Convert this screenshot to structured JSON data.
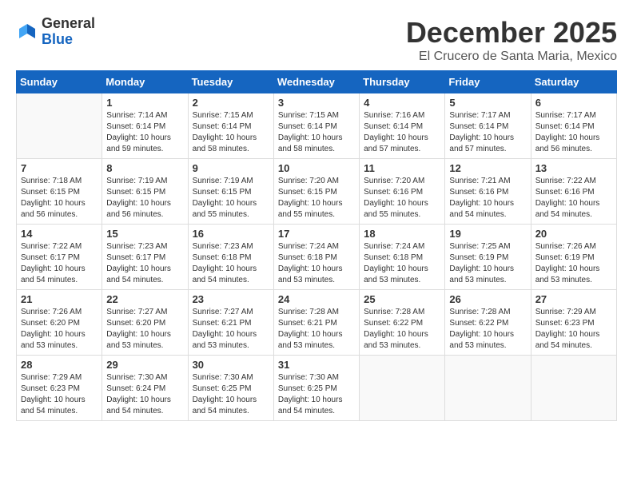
{
  "header": {
    "logo_general": "General",
    "logo_blue": "Blue",
    "month_year": "December 2025",
    "location": "El Crucero de Santa Maria, Mexico"
  },
  "days_of_week": [
    "Sunday",
    "Monday",
    "Tuesday",
    "Wednesday",
    "Thursday",
    "Friday",
    "Saturday"
  ],
  "weeks": [
    [
      {
        "day": "",
        "info": ""
      },
      {
        "day": "1",
        "info": "Sunrise: 7:14 AM\nSunset: 6:14 PM\nDaylight: 10 hours\nand 59 minutes."
      },
      {
        "day": "2",
        "info": "Sunrise: 7:15 AM\nSunset: 6:14 PM\nDaylight: 10 hours\nand 58 minutes."
      },
      {
        "day": "3",
        "info": "Sunrise: 7:15 AM\nSunset: 6:14 PM\nDaylight: 10 hours\nand 58 minutes."
      },
      {
        "day": "4",
        "info": "Sunrise: 7:16 AM\nSunset: 6:14 PM\nDaylight: 10 hours\nand 57 minutes."
      },
      {
        "day": "5",
        "info": "Sunrise: 7:17 AM\nSunset: 6:14 PM\nDaylight: 10 hours\nand 57 minutes."
      },
      {
        "day": "6",
        "info": "Sunrise: 7:17 AM\nSunset: 6:14 PM\nDaylight: 10 hours\nand 56 minutes."
      }
    ],
    [
      {
        "day": "7",
        "info": "Sunrise: 7:18 AM\nSunset: 6:15 PM\nDaylight: 10 hours\nand 56 minutes."
      },
      {
        "day": "8",
        "info": "Sunrise: 7:19 AM\nSunset: 6:15 PM\nDaylight: 10 hours\nand 56 minutes."
      },
      {
        "day": "9",
        "info": "Sunrise: 7:19 AM\nSunset: 6:15 PM\nDaylight: 10 hours\nand 55 minutes."
      },
      {
        "day": "10",
        "info": "Sunrise: 7:20 AM\nSunset: 6:15 PM\nDaylight: 10 hours\nand 55 minutes."
      },
      {
        "day": "11",
        "info": "Sunrise: 7:20 AM\nSunset: 6:16 PM\nDaylight: 10 hours\nand 55 minutes."
      },
      {
        "day": "12",
        "info": "Sunrise: 7:21 AM\nSunset: 6:16 PM\nDaylight: 10 hours\nand 54 minutes."
      },
      {
        "day": "13",
        "info": "Sunrise: 7:22 AM\nSunset: 6:16 PM\nDaylight: 10 hours\nand 54 minutes."
      }
    ],
    [
      {
        "day": "14",
        "info": "Sunrise: 7:22 AM\nSunset: 6:17 PM\nDaylight: 10 hours\nand 54 minutes."
      },
      {
        "day": "15",
        "info": "Sunrise: 7:23 AM\nSunset: 6:17 PM\nDaylight: 10 hours\nand 54 minutes."
      },
      {
        "day": "16",
        "info": "Sunrise: 7:23 AM\nSunset: 6:18 PM\nDaylight: 10 hours\nand 54 minutes."
      },
      {
        "day": "17",
        "info": "Sunrise: 7:24 AM\nSunset: 6:18 PM\nDaylight: 10 hours\nand 53 minutes."
      },
      {
        "day": "18",
        "info": "Sunrise: 7:24 AM\nSunset: 6:18 PM\nDaylight: 10 hours\nand 53 minutes."
      },
      {
        "day": "19",
        "info": "Sunrise: 7:25 AM\nSunset: 6:19 PM\nDaylight: 10 hours\nand 53 minutes."
      },
      {
        "day": "20",
        "info": "Sunrise: 7:26 AM\nSunset: 6:19 PM\nDaylight: 10 hours\nand 53 minutes."
      }
    ],
    [
      {
        "day": "21",
        "info": "Sunrise: 7:26 AM\nSunset: 6:20 PM\nDaylight: 10 hours\nand 53 minutes."
      },
      {
        "day": "22",
        "info": "Sunrise: 7:27 AM\nSunset: 6:20 PM\nDaylight: 10 hours\nand 53 minutes."
      },
      {
        "day": "23",
        "info": "Sunrise: 7:27 AM\nSunset: 6:21 PM\nDaylight: 10 hours\nand 53 minutes."
      },
      {
        "day": "24",
        "info": "Sunrise: 7:28 AM\nSunset: 6:21 PM\nDaylight: 10 hours\nand 53 minutes."
      },
      {
        "day": "25",
        "info": "Sunrise: 7:28 AM\nSunset: 6:22 PM\nDaylight: 10 hours\nand 53 minutes."
      },
      {
        "day": "26",
        "info": "Sunrise: 7:28 AM\nSunset: 6:22 PM\nDaylight: 10 hours\nand 53 minutes."
      },
      {
        "day": "27",
        "info": "Sunrise: 7:29 AM\nSunset: 6:23 PM\nDaylight: 10 hours\nand 54 minutes."
      }
    ],
    [
      {
        "day": "28",
        "info": "Sunrise: 7:29 AM\nSunset: 6:23 PM\nDaylight: 10 hours\nand 54 minutes."
      },
      {
        "day": "29",
        "info": "Sunrise: 7:30 AM\nSunset: 6:24 PM\nDaylight: 10 hours\nand 54 minutes."
      },
      {
        "day": "30",
        "info": "Sunrise: 7:30 AM\nSunset: 6:25 PM\nDaylight: 10 hours\nand 54 minutes."
      },
      {
        "day": "31",
        "info": "Sunrise: 7:30 AM\nSunset: 6:25 PM\nDaylight: 10 hours\nand 54 minutes."
      },
      {
        "day": "",
        "info": ""
      },
      {
        "day": "",
        "info": ""
      },
      {
        "day": "",
        "info": ""
      }
    ]
  ]
}
